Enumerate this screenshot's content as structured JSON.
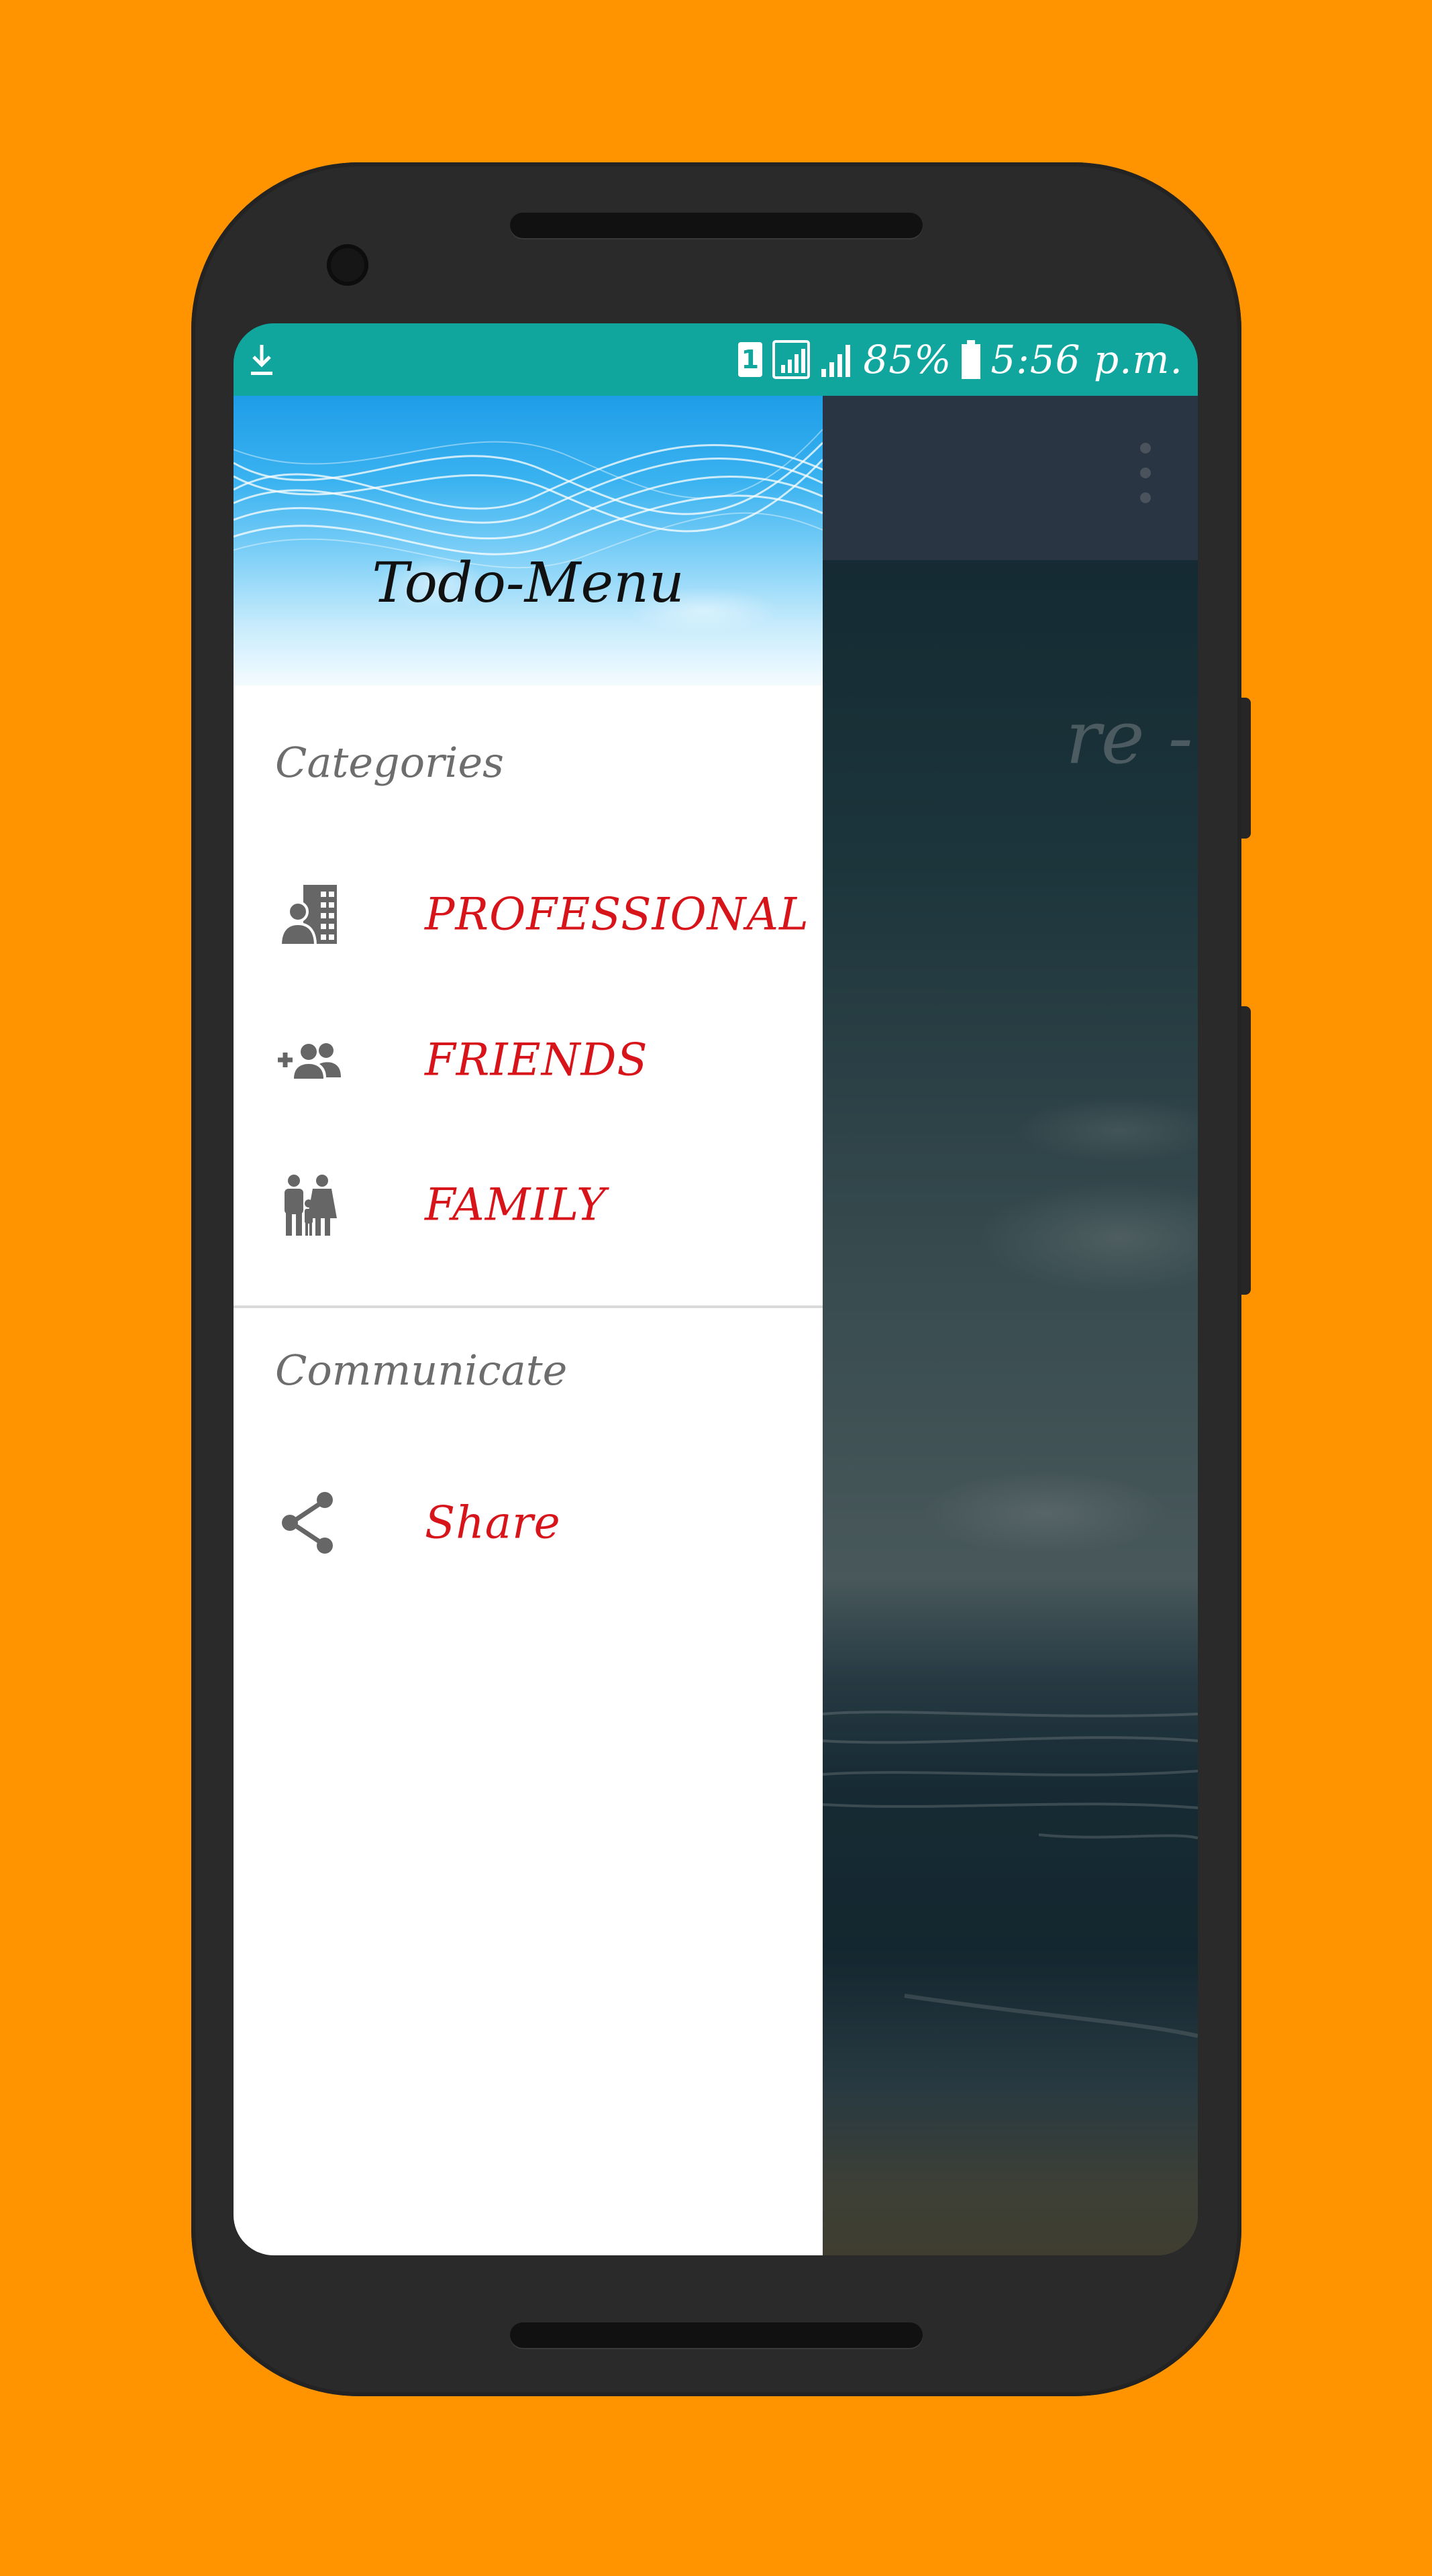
{
  "status_bar": {
    "sim_slot": "1",
    "battery": "85%",
    "time": "5:56 p.m."
  },
  "drawer": {
    "title": "Todo-Menu",
    "sections": [
      {
        "label": "Categories",
        "items": [
          {
            "label": "PROFESSIONAL",
            "icon": "business-contact-icon"
          },
          {
            "label": "FRIENDS",
            "icon": "group-add-icon"
          },
          {
            "label": "FAMILY",
            "icon": "family-icon"
          }
        ]
      },
      {
        "label": "Communicate",
        "items": [
          {
            "label": "Share",
            "icon": "share-icon"
          }
        ]
      }
    ]
  },
  "background": {
    "partial_text": "re -"
  },
  "colors": {
    "page_background": "#FF9400",
    "status_bar": "#10A69E",
    "app_bar": "#3E4F64",
    "menu_label": "#D8141B",
    "section_label": "#6D6D6D"
  }
}
